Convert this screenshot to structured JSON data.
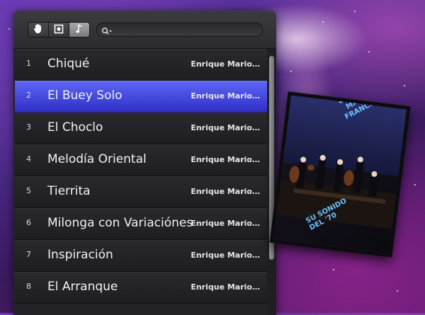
{
  "toolbar": {
    "modes": [
      {
        "icon": "hand-icon",
        "active": false
      },
      {
        "icon": "square-target-icon",
        "active": false
      },
      {
        "icon": "music-note-icon",
        "active": true
      }
    ],
    "search": {
      "placeholder": "",
      "value": ""
    }
  },
  "tracks": [
    {
      "num": "1",
      "title": "Chiqué",
      "artist": "Enrique Mario…",
      "selected": false
    },
    {
      "num": "2",
      "title": "El Buey Solo",
      "artist": "Enrique Mario…",
      "selected": true
    },
    {
      "num": "3",
      "title": "El Choclo",
      "artist": "Enrique Mario…",
      "selected": false
    },
    {
      "num": "4",
      "title": "Melodía Oriental",
      "artist": "Enrique Mario…",
      "selected": false
    },
    {
      "num": "5",
      "title": "Tierrita",
      "artist": "Enrique Mario…",
      "selected": false
    },
    {
      "num": "6",
      "title": "Milonga con Variaciónes",
      "artist": "Enrique Mario…",
      "selected": false
    },
    {
      "num": "7",
      "title": "Inspiración",
      "artist": "Enrique Mario…",
      "selected": false
    },
    {
      "num": "8",
      "title": "El Arranque",
      "artist": "Enrique Mario…",
      "selected": false
    }
  ],
  "album": {
    "cover_title_lines": [
      "ENRIQUE",
      "MARIO",
      "FRANCINI"
    ],
    "cover_subtitle_lines": [
      "SU SONIDO",
      "DEL '70"
    ]
  },
  "colors": {
    "selection": "#3a3ad6",
    "cover_text": "#6ec1ff"
  }
}
